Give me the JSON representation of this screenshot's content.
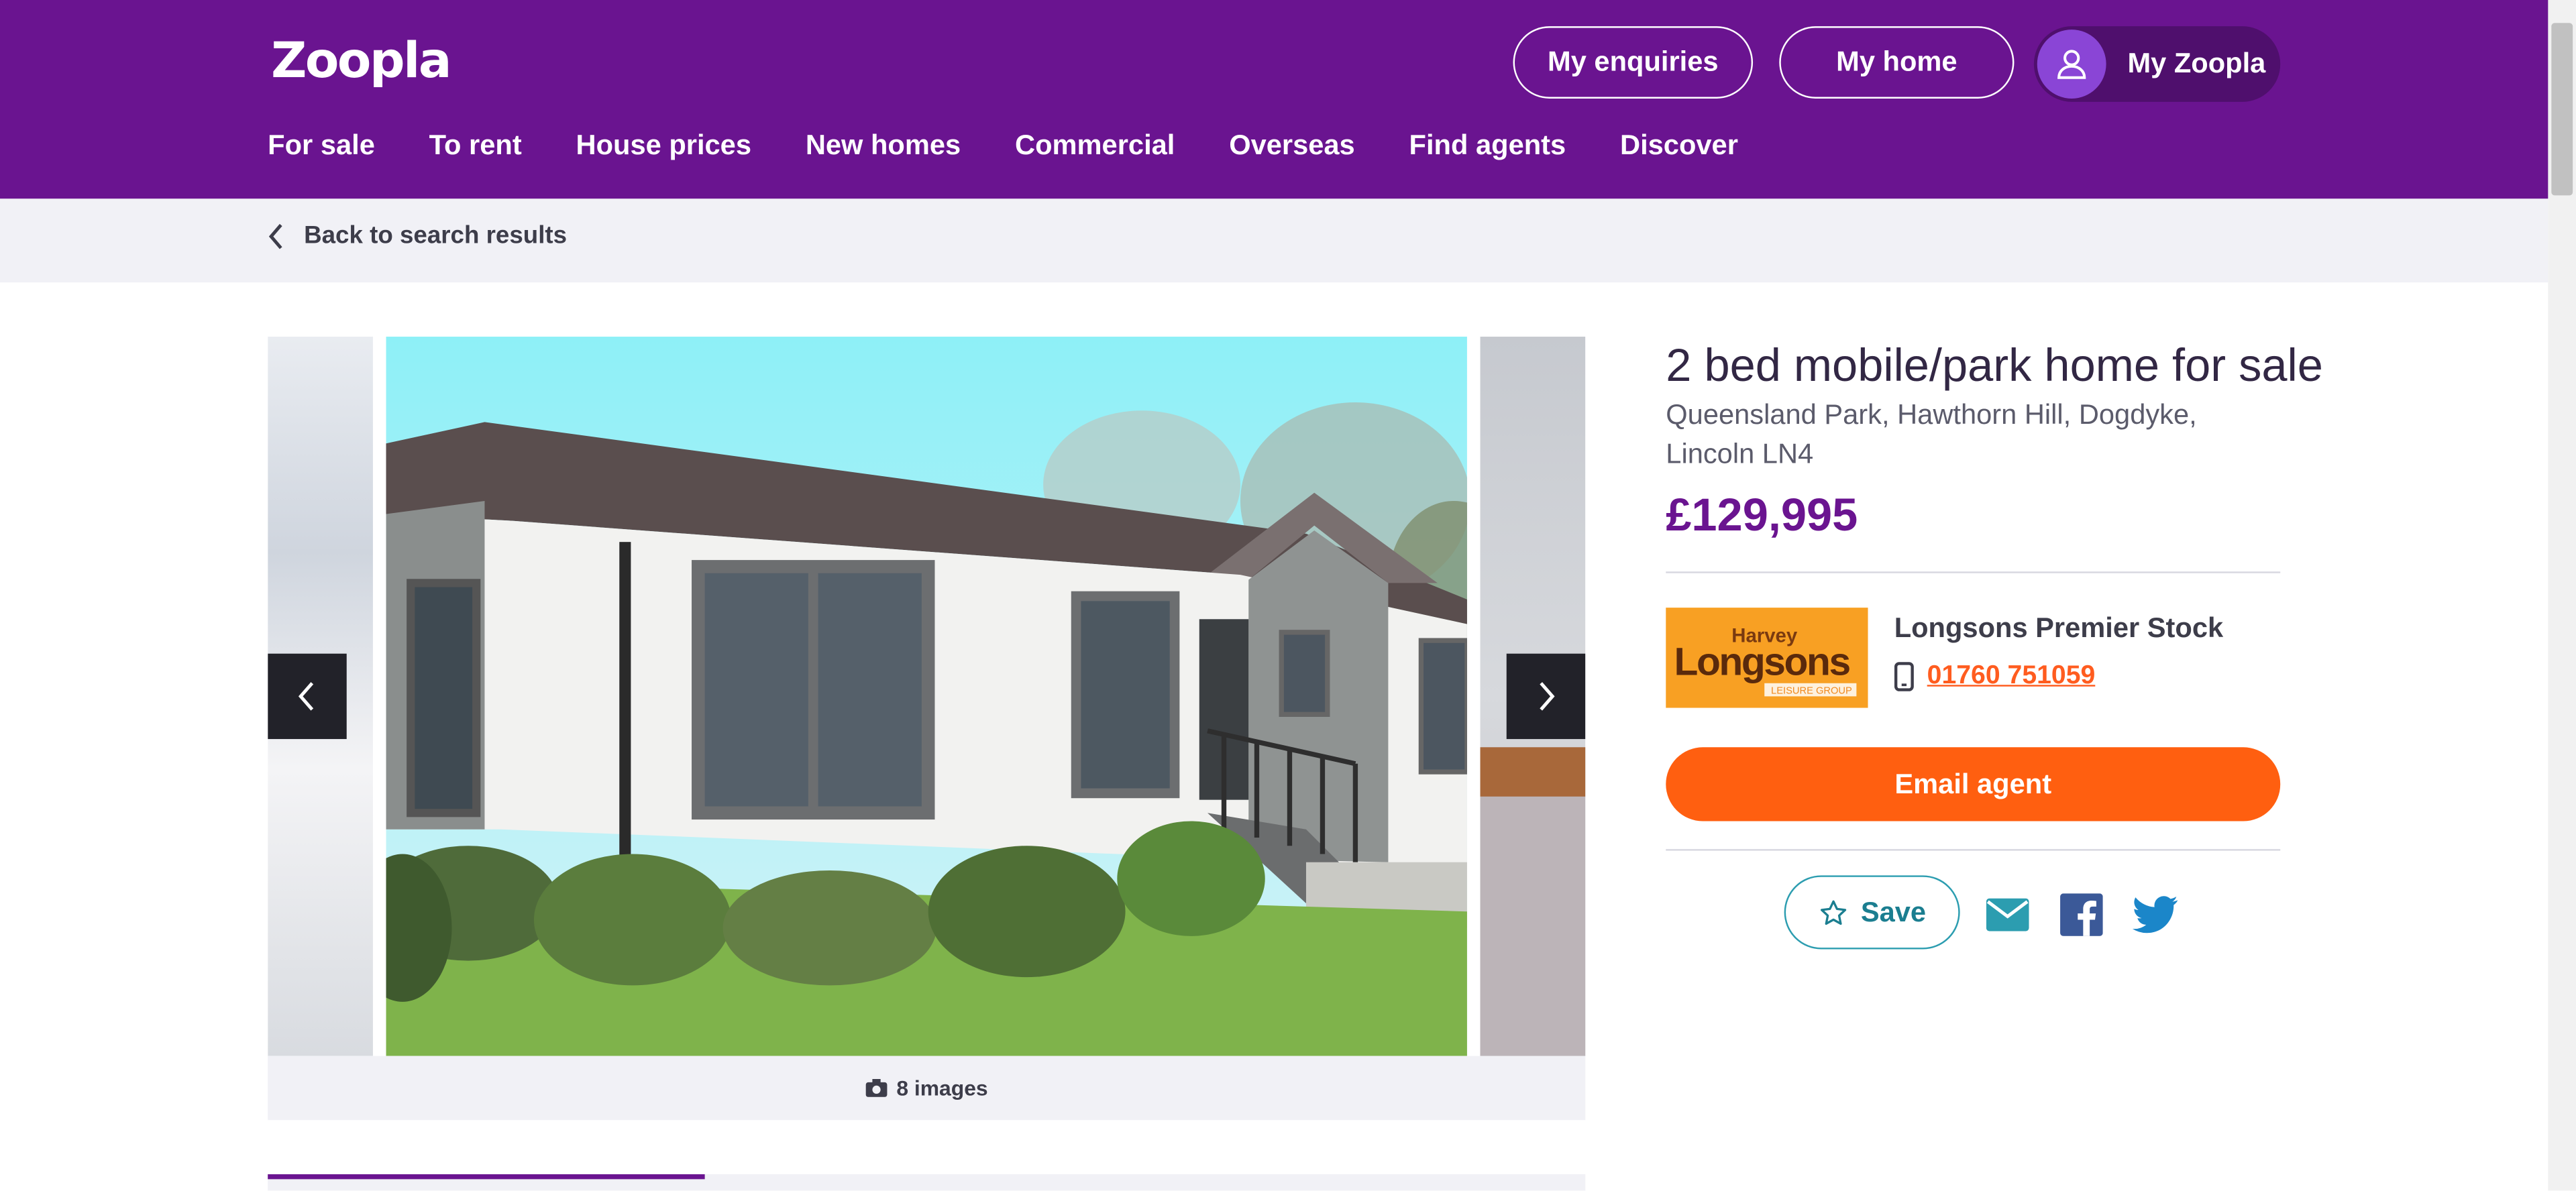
{
  "header": {
    "logo": "Zoopla",
    "buttons": {
      "enquiries": "My enquiries",
      "home": "My home",
      "account": "My Zoopla"
    },
    "nav": [
      "For sale",
      "To rent",
      "House prices",
      "New homes",
      "Commercial",
      "Overseas",
      "Find agents",
      "Discover"
    ]
  },
  "breadcrumb": {
    "back_label": "Back to search results"
  },
  "gallery": {
    "image_count_label": "8 images"
  },
  "listing": {
    "title": "2 bed mobile/park home for sale",
    "address_line1": "Queensland Park, Hawthorn Hill, Dogdyke,",
    "address_line2": "Lincoln LN4",
    "price": "£129,995"
  },
  "agent": {
    "logo_text_top": "Harvey",
    "logo_text_main": "Longsons",
    "logo_text_sub": "LEISURE GROUP",
    "name": "Longsons Premier Stock",
    "phone": "01760 751059"
  },
  "actions": {
    "email_label": "Email agent",
    "save_label": "Save"
  },
  "colors": {
    "brand": "#6a1490",
    "cta": "#ff5f10",
    "phone": "#ff5c1f",
    "save": "#2c9db0"
  }
}
